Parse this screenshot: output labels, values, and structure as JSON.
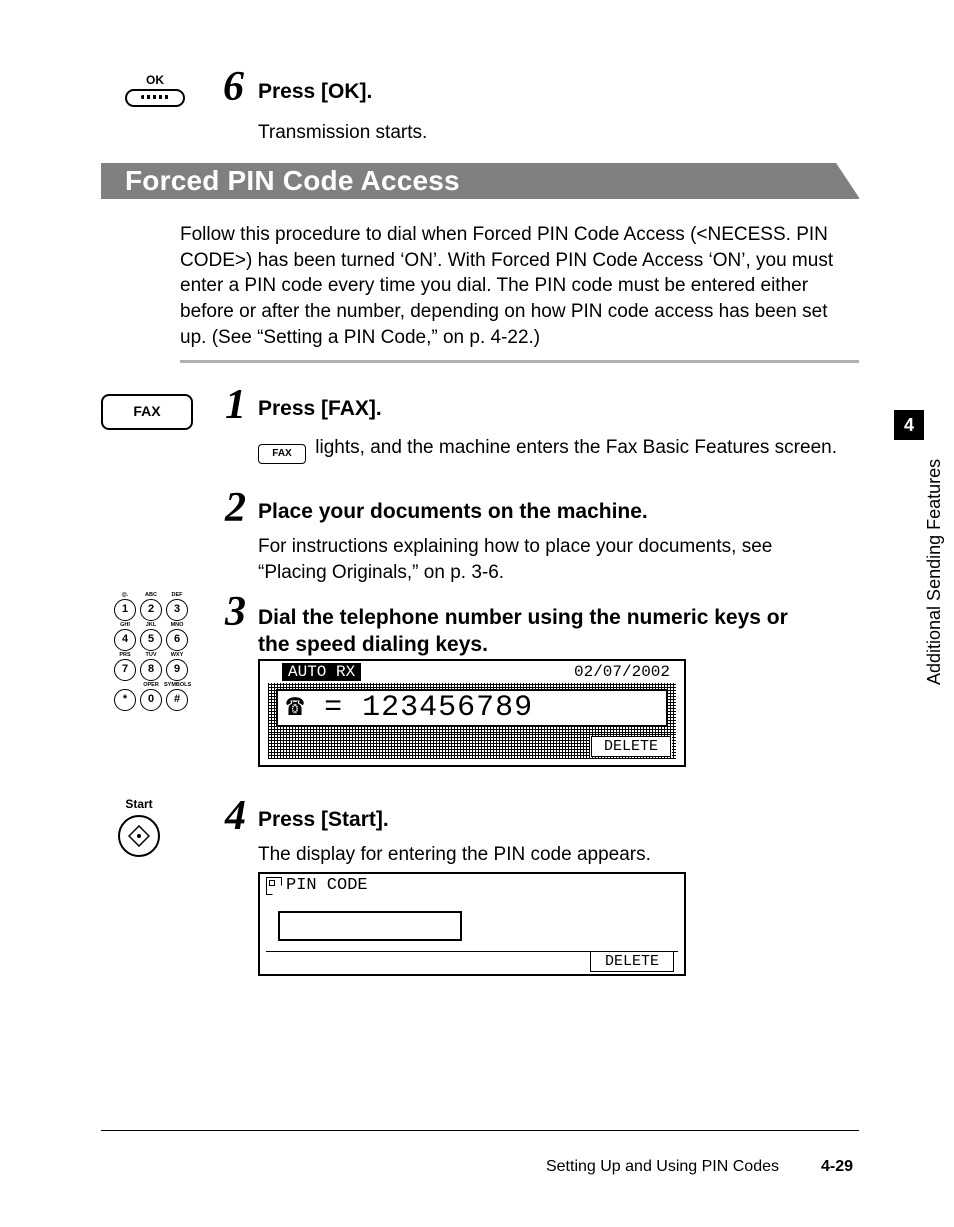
{
  "step6": {
    "ok_label": "OK",
    "num": "6",
    "title": "Press [OK].",
    "body": "Transmission starts."
  },
  "banner": "Forced PIN Code Access",
  "intro": "Follow this procedure to dial when Forced PIN Code Access (<NECESS. PIN CODE>) has been turned ‘ON’. With Forced PIN Code Access ‘ON’, you must enter a PIN code every time you dial. The PIN code must be entered either before or after the number, depending on how PIN code access has been set up. (See “Setting a PIN Code,” on p. 4-22.)",
  "step1": {
    "fax_key": "FAX",
    "num": "1",
    "title": "Press [FAX].",
    "inline_fax": "FAX",
    "body_tail": " lights, and the machine enters the Fax Basic Features screen."
  },
  "step2": {
    "num": "2",
    "title": "Place your documents on the machine.",
    "body": "For instructions explaining how to place your documents, see “Placing Originals,” on p. 3-6."
  },
  "keypad": {
    "labels": [
      "@.",
      "ABC",
      "DEF",
      "GHI",
      "JKL",
      "MNO",
      "PRS",
      "TUV",
      "WXY",
      "",
      "OPER",
      "SYMBOLS"
    ],
    "keys": [
      "1",
      "2",
      "3",
      "4",
      "5",
      "6",
      "7",
      "8",
      "9",
      "*",
      "0",
      "#"
    ]
  },
  "step3": {
    "num": "3",
    "title": "Dial the telephone number using the numeric keys or the speed dialing keys.",
    "lcd": {
      "mode": "AUTO RX",
      "date": "02/07/2002",
      "number": "☎ = 123456789",
      "delete": "DELETE"
    }
  },
  "step4": {
    "start_label": "Start",
    "num": "4",
    "title": "Press [Start].",
    "body": "The display for entering the PIN code appears.",
    "lcd": {
      "title": "PIN CODE",
      "delete": "DELETE"
    }
  },
  "side": {
    "chapter": "4",
    "label": "Additional Sending Features"
  },
  "footer": {
    "section": "Setting Up and Using PIN Codes",
    "page": "4-29"
  }
}
